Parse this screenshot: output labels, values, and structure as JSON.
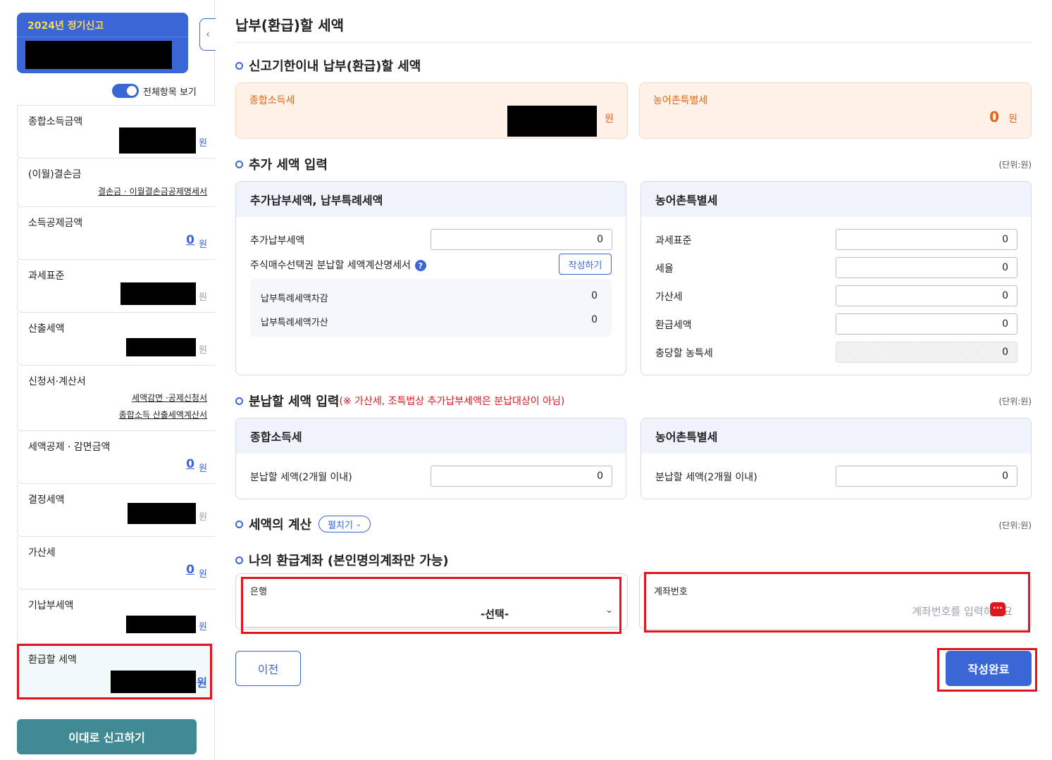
{
  "sidebar": {
    "filing_title": "2024년 정기신고",
    "toggle_label": "전체항목 보기",
    "won": "원",
    "items": [
      {
        "label": "종합소득금액"
      },
      {
        "label": "(이월)결손금",
        "link": "결손금 · 이월결손금공제명세서"
      },
      {
        "label": "소득공제금액",
        "value": "0"
      },
      {
        "label": "과세표준"
      },
      {
        "label": "산출세액"
      },
      {
        "label": "신청서·계산서",
        "link1": "세액감면 ·공제신청서",
        "link2": "종합소득 산출세액계산서"
      },
      {
        "label": "세액공제 · 감면금액",
        "value": "0"
      },
      {
        "label": "결정세액"
      },
      {
        "label": "가산세",
        "value": "0"
      },
      {
        "label": "기납부세액"
      },
      {
        "label": "환급할 세액"
      }
    ],
    "submit_label": "이대로 신고하기"
  },
  "main": {
    "page_title": "납부(환급)할 세액",
    "section1": {
      "title": "신고기한이내 납부(환급)할 세액",
      "income_tax_label": "종합소득세",
      "rural_tax_label": "농어촌특별세",
      "rural_tax_value": "0",
      "won": "원"
    },
    "section2": {
      "title": "추가 세액 입력",
      "unit": "(단위:원)",
      "left_panel": {
        "title": "추가납부세액, 납부특례세액",
        "additional_label": "추가납부세액",
        "additional_value": "0",
        "stock_label": "주식매수선택권 분납할 세액계산명세서",
        "help_icon": "?",
        "write_label": "작성하기",
        "deduct_label": "납부특례세액차감",
        "deduct_value": "0",
        "add_label": "납부특례세액가산",
        "add_value": "0"
      },
      "right_panel": {
        "title": "농어촌특별세",
        "rows": [
          {
            "label": "과세표준",
            "value": "0"
          },
          {
            "label": "세율",
            "value": "0"
          },
          {
            "label": "가산세",
            "value": "0"
          },
          {
            "label": "환급세액",
            "value": "0"
          },
          {
            "label": "충당할 농특세",
            "value": "0"
          }
        ]
      }
    },
    "section3": {
      "title": "분납할 세액 입력",
      "warning": "(※ 가산세, 조특법상 추가납부세액은 분납대상이 아님)",
      "unit": "(단위:원)",
      "left_title": "종합소득세",
      "right_title": "농어촌특별세",
      "row_label": "분납할 세액(2개월 이내)",
      "left_value": "0",
      "right_value": "0"
    },
    "section4": {
      "title": "세액의 계산",
      "expand_label": "펼치기",
      "unit": "(단위:원)"
    },
    "section5": {
      "title": "나의 환급계좌 (본인명의계좌만 가능)",
      "bank_label": "은행",
      "bank_value": "-선택-",
      "account_label": "계좌번호",
      "account_placeholder": "계좌번호를 입력하세요"
    },
    "prev_label": "이전",
    "done_label": "작성완료"
  },
  "colors": {
    "accent": "#3a66d6",
    "highlight_red": "#e0161f",
    "orange": "#e0661a",
    "teal": "#3f8a93"
  }
}
